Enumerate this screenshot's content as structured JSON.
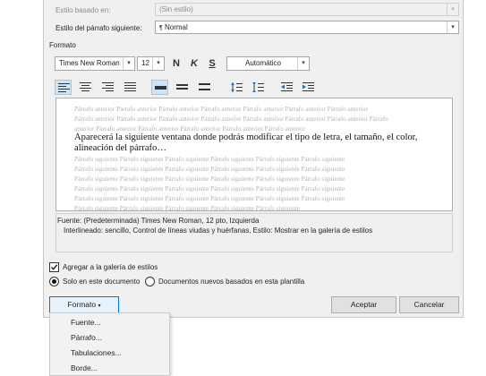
{
  "dialog": {
    "based_on_label": "Estilo basado en:",
    "based_on_value": "(Sin estilo)",
    "next_style_label": "Estilo del párrafo siguiente:",
    "next_style_value": "Normal",
    "next_style_icon": "paragraph-mark-icon",
    "format_section_label": "Formato"
  },
  "format_toolbar": {
    "font": "Times New Roman",
    "size": "12",
    "bold": "N",
    "italic": "K",
    "underline": "S",
    "color": "Automático"
  },
  "preview": {
    "prev_line_1": "Párrafo anterior Párrafo anterior Párrafo anterior Párrafo anterior Párrafo anterior Párrafo anterior Párrafo anterior",
    "prev_line_2": "Párrafo anterior Párrafo anterior Párrafo anterior Párrafo anterior Párrafo anterior Párrafo anterior Párrafo anterior Párrafo",
    "prev_line_3": "anterior Párrafo anterior Párrafo anterior Párrafo anterior Párrafo anterior Párrafo anterior",
    "sample_line_1": "Aparecerá la siguiente ventana donde podrás modificar el tipo de letra, el tamaño, el color,",
    "sample_line_2": "alineación del párrafo…",
    "next_line": "Párrafo siguiente Párrafo siguiente Párrafo siguiente Párrafo siguiente Párrafo siguiente Párrafo siguiente",
    "next_line_last": "Párrafo siguiente Párrafo siguiente Párrafo siguiente Párrafo siguiente Párrafo siguiente"
  },
  "description": {
    "line_1": "Fuente: (Predeterminada) Times New Roman, 12 pto, Izquierda",
    "line_2": "Interlineado:  sencillo, Control de líneas viudas y huérfanas, Estilo: Mostrar en la galería de estilos"
  },
  "options": {
    "add_gallery": "Agregar a la galería de estilos",
    "add_gallery_checked": true,
    "only_document": "Solo en este documento",
    "new_documents": "Documentos nuevos basados en esta plantilla"
  },
  "buttons": {
    "format": "Formato",
    "accept": "Aceptar",
    "cancel": "Cancelar"
  },
  "menu": {
    "items": [
      "Fuente...",
      "Párrafo...",
      "Tabulaciones...",
      "Borde..."
    ]
  },
  "colors": {
    "accent": "#0078d7",
    "selected_bg": "#cce4f7"
  }
}
